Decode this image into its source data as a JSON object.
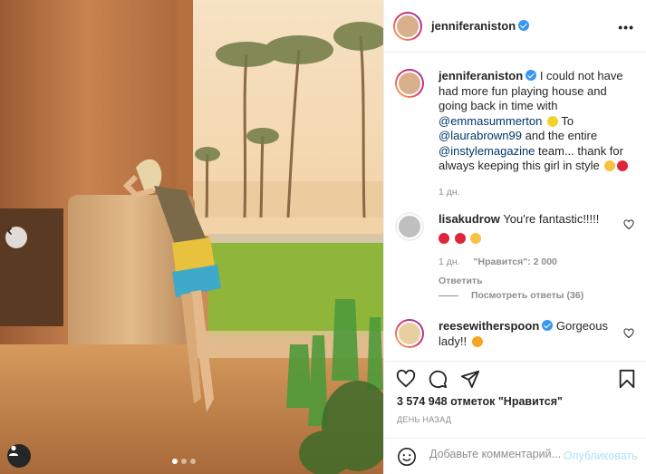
{
  "post": {
    "author": {
      "username": "jenniferaniston",
      "verified": true
    },
    "caption": {
      "text_1": "I could not have had more fun playing house and going back in time with",
      "mention_1": "@emmasummerton",
      "text_2": "To",
      "mention_2": "@laurabrown99",
      "text_3": "and the entire",
      "mention_3": "@instylemagazine",
      "text_4": "team... thank for always keeping this girl in style",
      "time": "1 дн."
    },
    "comments": [
      {
        "username": "lisakudrow",
        "verified": false,
        "text": "You're fantastic!!!!!",
        "time": "1 дн.",
        "likes": "\"Нравится\": 2 000",
        "reply_label": "Ответить",
        "view_replies": "Посмотреть ответы (36)"
      },
      {
        "username": "reesewitherspoon",
        "verified": true,
        "text_1": "Gorgeous",
        "text_2": "lady!!"
      }
    ],
    "likes_text": "3 574 948 отметок \"Нравится\"",
    "time_ago": "ДЕНЬ НАЗАД",
    "comment_box": {
      "placeholder": "Добавьте комментарий...",
      "publish_label": "Опубликовать"
    },
    "more_label": "•••"
  },
  "colors": {
    "link": "#00376b",
    "verified": "#3897f0",
    "heart": "#ed4956",
    "publish_disabled": "#b2dffc",
    "muted": "#8e8e8e"
  },
  "icons": [
    "heart-icon",
    "comment-icon",
    "share-icon",
    "bookmark-icon",
    "emoji-icon",
    "chevron-left-icon",
    "user-tag-icon"
  ]
}
